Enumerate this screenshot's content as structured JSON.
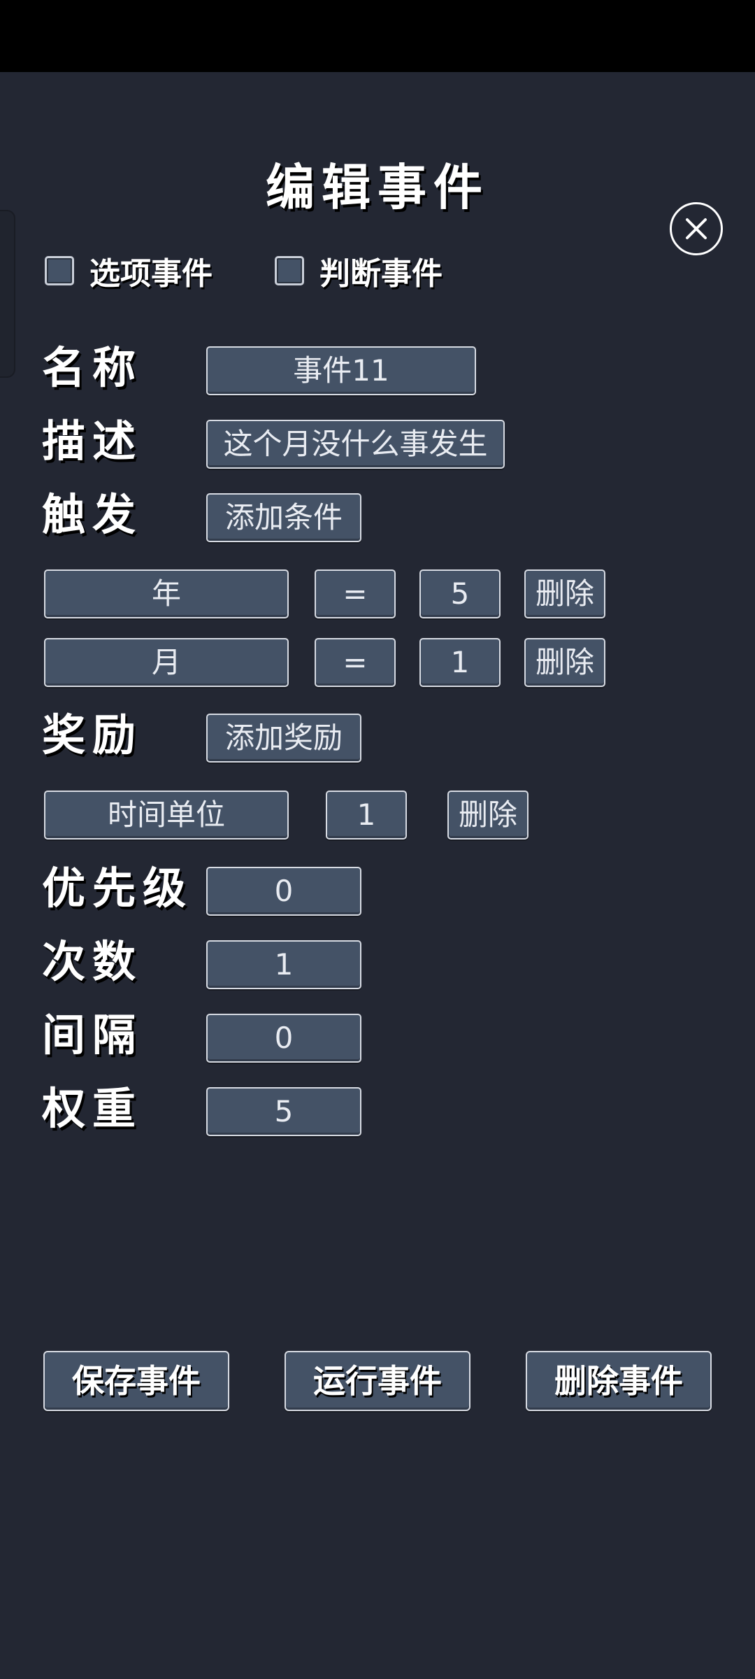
{
  "title": "编辑事件",
  "checkboxes": {
    "option_event": "选项事件",
    "judge_event": "判断事件"
  },
  "labels": {
    "name": "名称",
    "desc": "描述",
    "trigger": "触发",
    "reward": "奖励",
    "priority": "优先级",
    "count": "次数",
    "interval": "间隔",
    "weight": "权重"
  },
  "fields": {
    "name": "事件11",
    "desc": "这个月没什么事发生",
    "add_condition": "添加条件",
    "add_reward": "添加奖励",
    "priority": "0",
    "count": "1",
    "interval": "0",
    "weight": "5"
  },
  "conditions": [
    {
      "var": "年",
      "op": "=",
      "value": "5",
      "delete": "删除"
    },
    {
      "var": "月",
      "op": "=",
      "value": "1",
      "delete": "删除"
    }
  ],
  "rewards": [
    {
      "type": "时间单位",
      "value": "1",
      "delete": "删除"
    }
  ],
  "actions": {
    "save": "保存事件",
    "run": "运行事件",
    "delete": "删除事件"
  },
  "icons": {
    "close": "close-icon"
  },
  "colors": {
    "background": "#232733",
    "field": "#445266",
    "border": "#d7dbe3"
  }
}
